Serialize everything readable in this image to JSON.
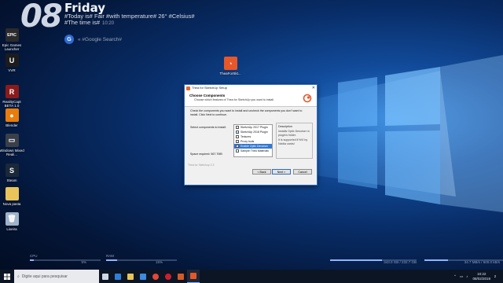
{
  "clock_widget": {
    "day_number": "08",
    "day_name": "Friday",
    "line1": "#Today is# Fair #with temperature# 26° #Celsius#",
    "line2": "#The time is#",
    "time_small": "10:20",
    "search_letter": "G",
    "search_placeholder": "« #Google Search#"
  },
  "desktop_icons": [
    {
      "label": "Epic Games Launcher",
      "icon": "epic-games-icon",
      "color": "#2b2b2b",
      "glyph": "EPIC"
    },
    {
      "label": "VVR",
      "icon": "unreal-icon",
      "color": "#1c1c1c",
      "glyph": "U"
    },
    {
      "label": "RealityCapt BETA 1.0",
      "icon": "reality-capture-icon",
      "color": "#8a1b1b",
      "glyph": "R"
    },
    {
      "label": "Blender",
      "icon": "blender-icon",
      "color": "#e87d0d",
      "glyph": "●"
    },
    {
      "label": "Windows Mixed Reali...",
      "icon": "mixed-reality-icon",
      "color": "#3a3f4a",
      "glyph": "▭"
    },
    {
      "label": "Steam",
      "icon": "steam-icon",
      "color": "#1b2838",
      "glyph": "S"
    },
    {
      "label": "Nova pasta",
      "icon": "folder-icon",
      "color": "#e8c45a",
      "glyph": ""
    },
    {
      "label": "Lixeira",
      "icon": "recycle-bin-icon",
      "color": "#9fb3c8",
      "glyph": "🗑"
    },
    {
      "label": "TheaForSkt...",
      "icon": "thea-installer-icon",
      "color": "#e6572a",
      "glyph": "◔"
    }
  ],
  "installer": {
    "title": "Thea for SketchUp Setup",
    "close_glyph": "✕",
    "header_title": "Choose Components",
    "header_sub": "Choose which features of Thea for SketchUp you want to install.",
    "intro": "Check the components you want to install and uncheck the components you don't want to install. Click Next to continue.",
    "select_caption": "Select components to install:",
    "components": [
      {
        "label": "SketchUp 2017 Plugin",
        "checked": true,
        "selected": false
      },
      {
        "label": "SketchUp 2018 Plugin",
        "checked": true,
        "selected": false
      },
      {
        "label": "Textures",
        "checked": false,
        "selected": false
      },
      {
        "label": "Proxy tools",
        "checked": true,
        "selected": false
      },
      {
        "label": "Enable Optix Denoiser",
        "checked": true,
        "selected": true
      },
      {
        "label": "Sample Thea Materials",
        "checked": false,
        "selected": false
      }
    ],
    "desc_heading": "Description",
    "desc_text1": "Installs Optix Denoiser in plugin's folder.",
    "desc_text2": "It is supported if NVI by Nvidia cards!",
    "space_required": "Space required: 567.7MB",
    "brand": "Thea for Sketchup 2.3",
    "back_label": "< Back",
    "next_label": "Next >",
    "cancel_label": "Cancel"
  },
  "meters": [
    {
      "label": "CPU",
      "value": "5%",
      "fill": 0.05
    },
    {
      "label": "RAM",
      "value": "15%",
      "fill": 0.15
    },
    {
      "label": "",
      "value": "343.0 GB / 232.7 GB",
      "fill": 0.6
    },
    {
      "label": "",
      "value": "34.7 MB/s / 500.0 kB/s",
      "fill": 0.3
    }
  ],
  "taskbar": {
    "search_placeholder": "Digite aqui para pesquisar",
    "apps": [
      {
        "icon": "task-view-icon",
        "color": "#cfd6e4"
      },
      {
        "icon": "edge-icon",
        "color": "#2f7fd8"
      },
      {
        "icon": "file-explorer-icon",
        "color": "#e8c45a"
      },
      {
        "icon": "store-icon",
        "color": "#3b8be0"
      },
      {
        "icon": "chrome-icon",
        "color": "#e0483a"
      },
      {
        "icon": "opera-icon",
        "color": "#cc1f2f"
      },
      {
        "icon": "sketchup-icon",
        "color": "#d45a2a"
      },
      {
        "icon": "thea-icon",
        "color": "#e6572a"
      }
    ],
    "time": "10:22",
    "date": "08/02/2019",
    "notification_count": "2"
  }
}
